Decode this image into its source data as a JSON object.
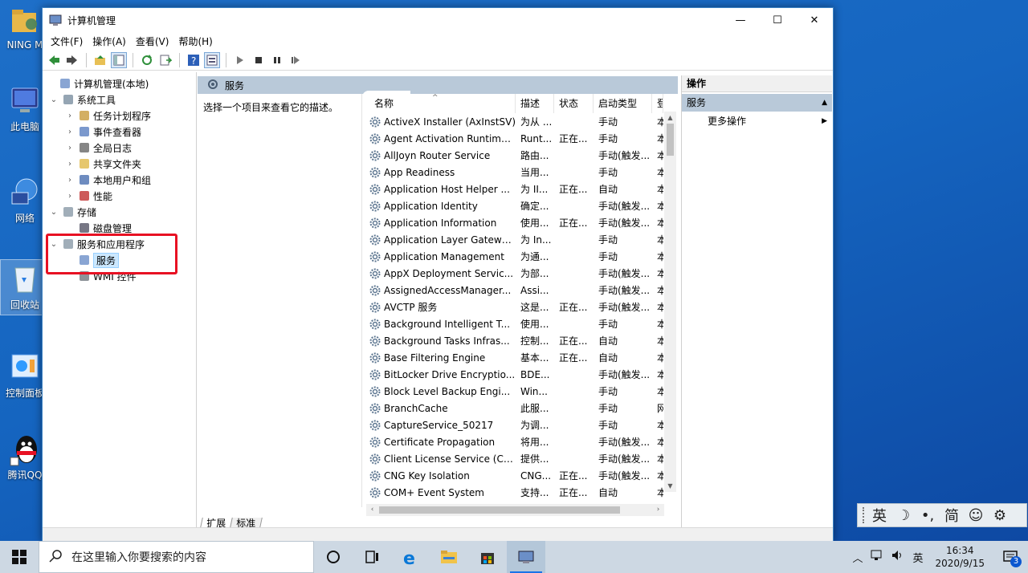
{
  "desktop": {
    "icons": [
      {
        "label": "NING M"
      },
      {
        "label": "此电脑"
      },
      {
        "label": "网络"
      },
      {
        "label": "回收站"
      },
      {
        "label": "控制面板"
      },
      {
        "label": "腾讯QQ"
      }
    ]
  },
  "window": {
    "title": "计算机管理",
    "controls": {
      "minimize": "—",
      "maximize": "☐",
      "close": "✕"
    },
    "menu": [
      "文件(F)",
      "操作(A)",
      "查看(V)",
      "帮助(H)"
    ]
  },
  "tree": {
    "items": [
      {
        "label": "计算机管理(本地)",
        "level": 0,
        "expander": "",
        "icon": "computer-management-icon"
      },
      {
        "label": "系统工具",
        "level": 1,
        "expander": "⌄",
        "icon": "system-tools-icon"
      },
      {
        "label": "任务计划程序",
        "level": 2,
        "expander": "›",
        "icon": "task-scheduler-icon"
      },
      {
        "label": "事件查看器",
        "level": 2,
        "expander": "›",
        "icon": "event-viewer-icon"
      },
      {
        "label": "全局日志",
        "level": 2,
        "expander": "›",
        "icon": "global-log-icon"
      },
      {
        "label": "共享文件夹",
        "level": 2,
        "expander": "›",
        "icon": "shared-folders-icon"
      },
      {
        "label": "本地用户和组",
        "level": 2,
        "expander": "›",
        "icon": "local-users-icon"
      },
      {
        "label": "性能",
        "level": 2,
        "expander": "›",
        "icon": "performance-icon"
      },
      {
        "label": "存储",
        "level": 1,
        "expander": "⌄",
        "icon": "storage-icon"
      },
      {
        "label": "磁盘管理",
        "level": 2,
        "expander": "",
        "icon": "disk-management-icon"
      },
      {
        "label": "服务和应用程序",
        "level": 1,
        "expander": "⌄",
        "icon": "services-apps-icon"
      },
      {
        "label": "服务",
        "level": 2,
        "expander": "",
        "icon": "services-icon",
        "selected": true
      },
      {
        "label": "WMI 控件",
        "level": 2,
        "expander": "",
        "icon": "wmi-icon"
      }
    ]
  },
  "middle": {
    "header": "服务",
    "description": "选择一个项目来查看它的描述。",
    "columns": {
      "name": "名称",
      "desc": "描述",
      "status": "状态",
      "startup": "启动类型",
      "logon": "登"
    },
    "rows": [
      {
        "name": "ActiveX Installer (AxInstSV)",
        "desc": "为从 ...",
        "status": "",
        "startup": "手动",
        "logon": "本"
      },
      {
        "name": "Agent Activation Runtime...",
        "desc": "Runt...",
        "status": "正在...",
        "startup": "手动",
        "logon": "本"
      },
      {
        "name": "AllJoyn Router Service",
        "desc": "路由...",
        "status": "",
        "startup": "手动(触发...",
        "logon": "本"
      },
      {
        "name": "App Readiness",
        "desc": "当用...",
        "status": "",
        "startup": "手动",
        "logon": "本"
      },
      {
        "name": "Application Host Helper ...",
        "desc": "为 II...",
        "status": "正在...",
        "startup": "自动",
        "logon": "本"
      },
      {
        "name": "Application Identity",
        "desc": "确定...",
        "status": "",
        "startup": "手动(触发...",
        "logon": "本"
      },
      {
        "name": "Application Information",
        "desc": "使用...",
        "status": "正在...",
        "startup": "手动(触发...",
        "logon": "本"
      },
      {
        "name": "Application Layer Gatewa...",
        "desc": "为 In...",
        "status": "",
        "startup": "手动",
        "logon": "本"
      },
      {
        "name": "Application Management",
        "desc": "为通...",
        "status": "",
        "startup": "手动",
        "logon": "本"
      },
      {
        "name": "AppX Deployment Servic...",
        "desc": "为部...",
        "status": "",
        "startup": "手动(触发...",
        "logon": "本"
      },
      {
        "name": "AssignedAccessManager...",
        "desc": "Assi...",
        "status": "",
        "startup": "手动(触发...",
        "logon": "本"
      },
      {
        "name": "AVCTP 服务",
        "desc": "这是...",
        "status": "正在...",
        "startup": "手动(触发...",
        "logon": "本"
      },
      {
        "name": "Background Intelligent T...",
        "desc": "使用...",
        "status": "",
        "startup": "手动",
        "logon": "本"
      },
      {
        "name": "Background Tasks Infras...",
        "desc": "控制...",
        "status": "正在...",
        "startup": "自动",
        "logon": "本"
      },
      {
        "name": "Base Filtering Engine",
        "desc": "基本...",
        "status": "正在...",
        "startup": "自动",
        "logon": "本"
      },
      {
        "name": "BitLocker Drive Encryptio...",
        "desc": "BDE...",
        "status": "",
        "startup": "手动(触发...",
        "logon": "本"
      },
      {
        "name": "Block Level Backup Engi...",
        "desc": "Win...",
        "status": "",
        "startup": "手动",
        "logon": "本"
      },
      {
        "name": "BranchCache",
        "desc": "此服...",
        "status": "",
        "startup": "手动",
        "logon": "网"
      },
      {
        "name": "CaptureService_50217",
        "desc": "为调...",
        "status": "",
        "startup": "手动",
        "logon": "本"
      },
      {
        "name": "Certificate Propagation",
        "desc": "将用...",
        "status": "",
        "startup": "手动(触发...",
        "logon": "本"
      },
      {
        "name": "Client License Service (Cli...",
        "desc": "提供...",
        "status": "",
        "startup": "手动(触发...",
        "logon": "本"
      },
      {
        "name": "CNG Key Isolation",
        "desc": "CNG...",
        "status": "正在...",
        "startup": "手动(触发...",
        "logon": "本"
      },
      {
        "name": "COM+ Event System",
        "desc": "支持...",
        "status": "正在...",
        "startup": "自动",
        "logon": "本"
      }
    ],
    "tabs": [
      "扩展",
      "标准"
    ]
  },
  "actions": {
    "header": "操作",
    "section": "服务",
    "items": [
      "更多操作"
    ]
  },
  "ime": {
    "buttons": [
      "英",
      "☽",
      "•,",
      "简",
      "☺",
      "⚙"
    ]
  },
  "taskbar": {
    "search_placeholder": "在这里输入你要搜索的内容",
    "tray_lang": "英",
    "time": "16:34",
    "date": "2020/9/15",
    "notification_count": "3"
  }
}
